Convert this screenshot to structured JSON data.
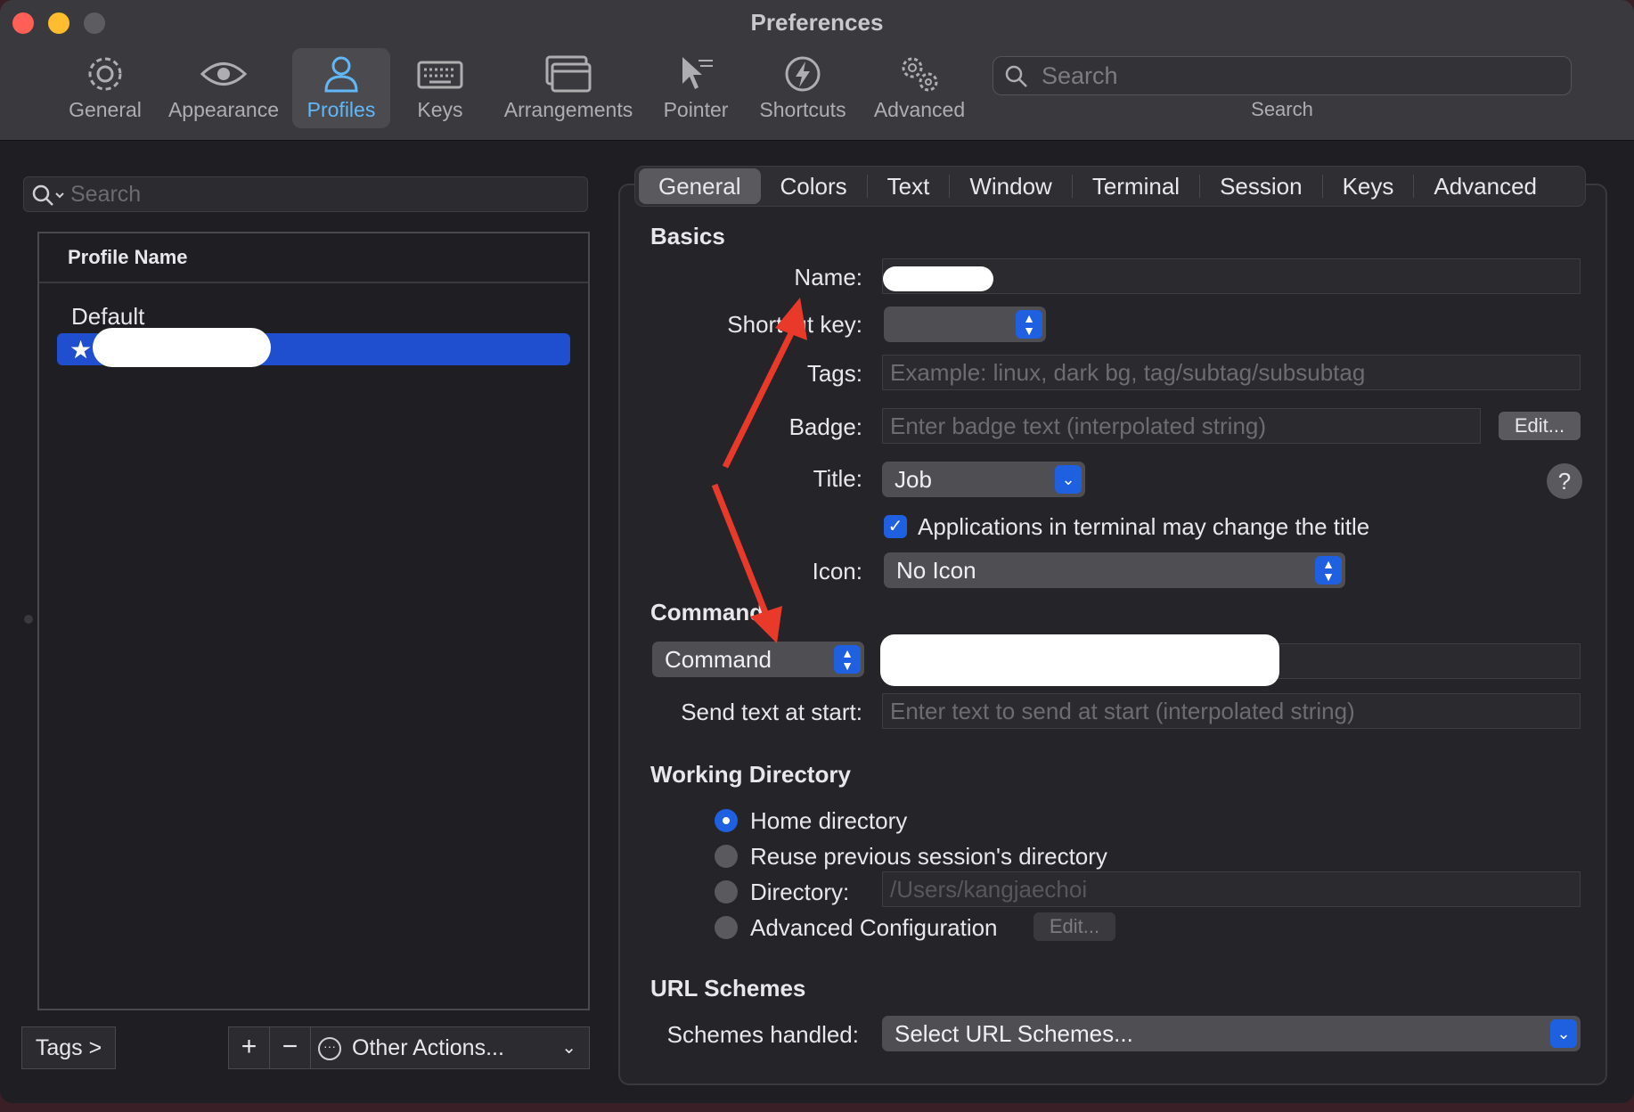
{
  "window": {
    "title": "Preferences"
  },
  "toolbar": {
    "items": [
      {
        "label": "General",
        "icon": "gear-icon"
      },
      {
        "label": "Appearance",
        "icon": "eye-icon"
      },
      {
        "label": "Profiles",
        "icon": "person-icon"
      },
      {
        "label": "Keys",
        "icon": "keyboard-icon"
      },
      {
        "label": "Arrangements",
        "icon": "windows-icon"
      },
      {
        "label": "Pointer",
        "icon": "pointer-icon"
      },
      {
        "label": "Shortcuts",
        "icon": "bolt-icon"
      },
      {
        "label": "Advanced",
        "icon": "gears-icon"
      }
    ],
    "active": "Profiles",
    "search_placeholder": "Search",
    "search_caption": "Search"
  },
  "profiles": {
    "search_placeholder": "Search",
    "column_header": "Profile Name",
    "default_label": "Default",
    "selected_marker": "★",
    "tags_button": "Tags >",
    "add_symbol": "+",
    "remove_symbol": "−",
    "other_actions": "Other Actions...",
    "other_actions_chevron": "⌄"
  },
  "tabs": [
    "General",
    "Colors",
    "Text",
    "Window",
    "Terminal",
    "Session",
    "Keys",
    "Advanced"
  ],
  "basics": {
    "section": "Basics",
    "name_label": "Name:",
    "shortcut_label": "Shortcut key:",
    "tags_label": "Tags:",
    "tags_placeholder": "Example: linux, dark bg, tag/subtag/subsubtag",
    "badge_label": "Badge:",
    "badge_placeholder": "Enter badge text (interpolated string)",
    "badge_edit": "Edit...",
    "title_label": "Title:",
    "title_value": "Job",
    "help": "?",
    "apps_change_title": "Applications in terminal may change the title",
    "icon_label": "Icon:",
    "icon_value": "No Icon"
  },
  "command": {
    "section": "Command",
    "mode_value": "Command",
    "send_text_label": "Send text at start:",
    "send_text_placeholder": "Enter text to send at start (interpolated string)"
  },
  "working_directory": {
    "section": "Working Directory",
    "home": "Home directory",
    "reuse": "Reuse previous session's directory",
    "directory": "Directory:",
    "directory_value": "/Users/kangjaechoi",
    "advanced": "Advanced Configuration",
    "advanced_edit": "Edit...",
    "selected": "home"
  },
  "url_schemes": {
    "section": "URL Schemes",
    "handled_label": "Schemes handled:",
    "select_value": "Select URL Schemes..."
  },
  "colors": {
    "accent": "#1f60e0",
    "active_tab_text": "#62b7f7",
    "annotation_arrow": "#e8392a"
  }
}
